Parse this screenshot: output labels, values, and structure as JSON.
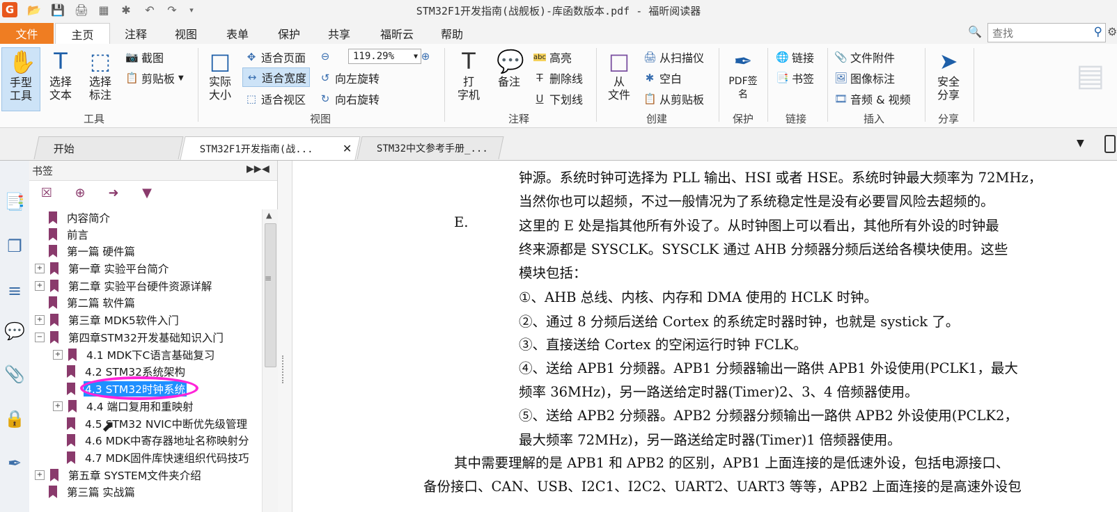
{
  "titlebar": {
    "logo": "G",
    "title": "STM32F1开发指南(战舰板)-库函数版本.pdf - 福昕阅读器"
  },
  "menu": {
    "file": "文件",
    "tabs": [
      "主页",
      "注释",
      "视图",
      "表单",
      "保护",
      "共享",
      "福昕云",
      "帮助"
    ]
  },
  "search": {
    "placeholder": "查找"
  },
  "ribbon": {
    "tools": {
      "hand": "手型\n工具",
      "select_text": "选择\n文本",
      "select_annot": "选择\n标注",
      "snapshot": "截图",
      "clipboard": "剪贴板",
      "group": "工具"
    },
    "view": {
      "actual_size": "实际\n大小",
      "fit_page": "适合页面",
      "fit_width": "适合宽度",
      "fit_visible": "适合视区",
      "zoom_value": "119.29%",
      "rotate_left": "向左旋转",
      "rotate_right": "向右旋转",
      "group": "视图"
    },
    "annotate": {
      "typewriter": "打\n字机",
      "note": "备注",
      "highlight": "高亮",
      "strikeout": "删除线",
      "underline": "下划线",
      "group": "注释"
    },
    "create": {
      "from_file": "从\n文件",
      "from_scanner": "从扫描仪",
      "blank": "空白",
      "from_clipboard": "从剪贴板",
      "group": "创建"
    },
    "protect": {
      "sign": "PDF签\n名",
      "group": "保护"
    },
    "links": {
      "link": "链接",
      "bookmark": "书签",
      "group": "链接"
    },
    "insert": {
      "attachment": "文件附件",
      "image": "图像标注",
      "media": "音频 & 视频",
      "group": "插入"
    },
    "share": {
      "secure": "安全\n分享",
      "group": "分享"
    }
  },
  "doc_tabs": [
    "开始",
    "STM32F1开发指南(战...",
    "STM32中文参考手册_..."
  ],
  "bookmarks": {
    "title": "书签",
    "items": [
      {
        "label": "内容简介",
        "level": 0,
        "expand": false
      },
      {
        "label": "前言",
        "level": 0,
        "expand": false
      },
      {
        "label": "第一篇 硬件篇",
        "level": 0,
        "expand": false
      },
      {
        "label": "第一章 实验平台简介",
        "level": 0,
        "expand": true
      },
      {
        "label": "第二章 实验平台硬件资源详解",
        "level": 0,
        "expand": true
      },
      {
        "label": "第二篇 软件篇",
        "level": 0,
        "expand": false
      },
      {
        "label": "第三章 MDK5软件入门",
        "level": 0,
        "expand": true
      },
      {
        "label": "第四章STM32开发基础知识入门",
        "level": 0,
        "expand": true
      },
      {
        "label": "4.1 MDK下C语言基础复习",
        "level": 1,
        "expand": true
      },
      {
        "label": "4.2 STM32系统架构",
        "level": 1,
        "expand": false
      },
      {
        "label": "4.3 STM32时钟系统",
        "level": 1,
        "expand": false
      },
      {
        "label": "4.4 端口复用和重映射",
        "level": 1,
        "expand": true
      },
      {
        "label": "4.5 STM32 NVIC中断优先级管理",
        "level": 1,
        "expand": false
      },
      {
        "label": "4.6 MDK中寄存器地址名称映射分",
        "level": 1,
        "expand": false
      },
      {
        "label": "4.7 MDK固件库快速组织代码技巧",
        "level": 1,
        "expand": false
      },
      {
        "label": "第五章 SYSTEM文件夹介绍",
        "level": 0,
        "expand": true
      },
      {
        "label": "第三篇 实战篇",
        "level": 0,
        "expand": false
      }
    ]
  },
  "document": {
    "lines": [
      "钟源。系统时钟可选择为 PLL 输出、HSI 或者 HSE。系统时钟最大频率为 72MHz，",
      "当然你也可以超频，不过一般情况为了系统稳定性是没有必要冒风险去超频的。",
      "这里的 E 处是指其他所有外设了。从时钟图上可以看出，其他所有外设的时钟最",
      "终来源都是 SYSCLK。SYSCLK 通过 AHB 分频器分频后送给各模块使用。这些",
      "模块包括：",
      "①、AHB 总线、内核、内存和 DMA 使用的 HCLK 时钟。",
      "②、通过 8 分频后送给 Cortex 的系统定时器时钟，也就是 systick 了。",
      "③、直接送给 Cortex 的空闲运行时钟 FCLK。",
      "④、送给 APB1 分频器。APB1 分频器输出一路供 APB1 外设使用(PCLK1，最大",
      "频率 36MHz)，另一路送给定时器(Timer)2、3、4 倍频器使用。",
      "⑤、送给 APB2 分频器。APB2 分频器分频输出一路供 APB2 外设使用(PCLK2，",
      "最大频率 72MHz)，另一路送给定时器(Timer)1 倍频器使用。",
      "其中需要理解的是 APB1 和 APB2 的区别，APB1 上面连接的是低速外设，包括电源接口、",
      "备份接口、CAN、USB、I2C1、I2C2、UART2、UART3 等等，APB2 上面连接的是高速外设包"
    ],
    "item_label": "E."
  }
}
